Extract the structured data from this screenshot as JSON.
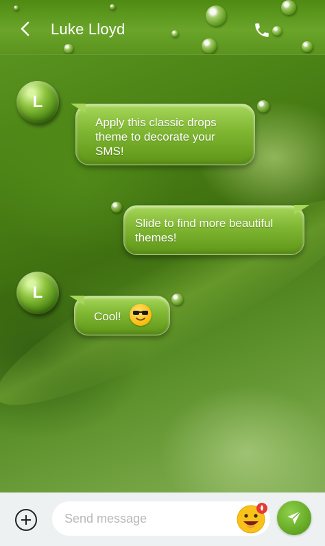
{
  "header": {
    "title": "Luke Lloyd",
    "back_icon": "chevron-left-icon",
    "call_icon": "phone-icon"
  },
  "messages": [
    {
      "direction": "incoming",
      "avatar_initial": "L",
      "text": "Apply this classic drops\ntheme to decorate your\nSMS!"
    },
    {
      "direction": "outgoing",
      "text": "Slide to find more beautiful\nthemes!"
    },
    {
      "direction": "incoming",
      "avatar_initial": "L",
      "text": "Cool!",
      "emoji": "sunglasses-emoji"
    }
  ],
  "composer": {
    "add_icon": "plus-circle-icon",
    "placeholder": "Send message",
    "emoji_icon": "grinning-face-emoji",
    "send_icon": "send-icon"
  },
  "theme": {
    "accent": "#7fb631",
    "bubble_light": "#a6d65a",
    "bubble_dark": "#5e9518",
    "send_button": "#6fb32c",
    "bottom_bar": "#eef1f2"
  }
}
